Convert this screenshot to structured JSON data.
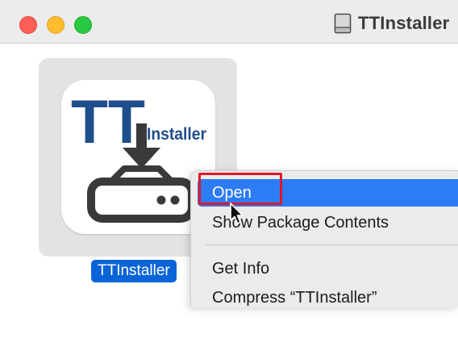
{
  "window": {
    "title": "TTInstaller",
    "disk_icon": "disk-image-icon",
    "controls": [
      "close",
      "minimize",
      "maximize"
    ]
  },
  "file": {
    "name": "TTInstaller",
    "icon": {
      "name": "ttinstaller-app-icon",
      "big_text": "TT",
      "small_text": "Installer",
      "colors": {
        "text": "#1f4e8c",
        "drive": "#3a3a3a",
        "tile": "#e3e3e3"
      }
    }
  },
  "context_menu": {
    "items": [
      {
        "label": "Open",
        "selected": true
      },
      {
        "label": "Show Package Contents"
      },
      {
        "label": "Get Info"
      },
      {
        "label": "Compress “TTInstaller”"
      }
    ]
  },
  "colors": {
    "selection": "#2d7cf6",
    "label_selection": "#0a64d8",
    "highlight_box": "#e0172c"
  }
}
